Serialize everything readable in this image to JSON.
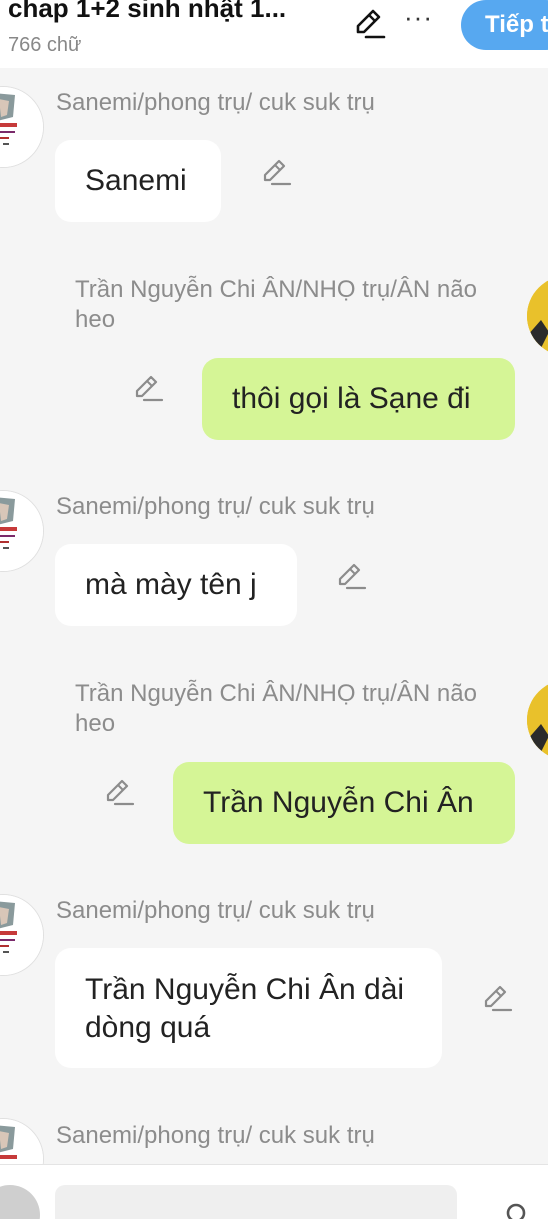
{
  "header": {
    "title": "chap 1+2 sinh nhật 1...",
    "word_count": "766 chữ",
    "next_label": "Tiếp t",
    "more_label": "···"
  },
  "messages": [
    {
      "side": "left",
      "sender": "Sanemi/phong trụ/ cuk suk trụ",
      "text": "Sanemi"
    },
    {
      "side": "right",
      "sender": "Trần Nguyễn Chi ÂN/NHỌ trụ/ÂN não heo",
      "text": "thôi gọi là Sạne đi"
    },
    {
      "side": "left",
      "sender": "Sanemi/phong trụ/ cuk suk trụ",
      "text": "mà mày tên j"
    },
    {
      "side": "right",
      "sender": "Trần Nguyễn Chi ÂN/NHỌ trụ/ÂN não heo",
      "text": "Trần Nguyễn Chi Ân"
    },
    {
      "side": "left",
      "sender": "Sanemi/phong trụ/ cuk suk trụ",
      "text": "Trần Nguyễn Chi Ân dài dòng quá"
    },
    {
      "side": "left",
      "sender": "Sanemi/phong trụ/ cuk suk trụ",
      "text": ""
    }
  ],
  "icons": {
    "edit": "pencil-icon",
    "more": "more-dots-icon",
    "profile": "person-icon"
  },
  "colors": {
    "accent": "#57a8f0",
    "bubble_left": "#ffffff",
    "bubble_right": "#d5f596",
    "background": "#f5f5f5"
  }
}
